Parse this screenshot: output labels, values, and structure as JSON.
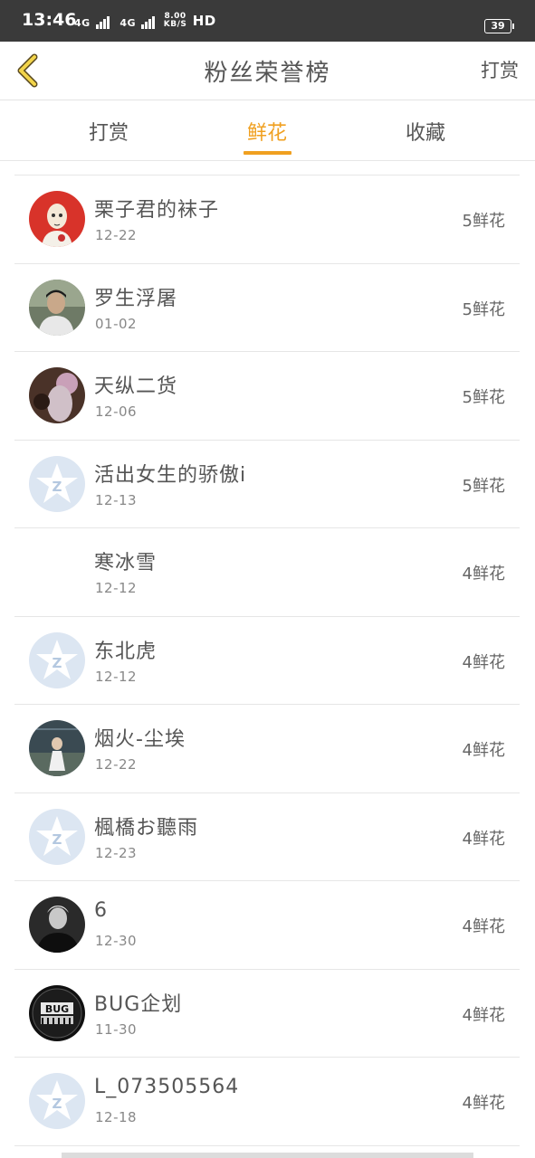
{
  "status_bar": {
    "time": "13:46",
    "network_1": "4G",
    "network_2": "4G",
    "speed_value": "8.00",
    "speed_unit": "KB/S",
    "hd": "HD",
    "battery": "39"
  },
  "header": {
    "title": "粉丝荣誉榜",
    "right_button": "打赏",
    "back_icon": "chevron-left-icon"
  },
  "tabs": [
    {
      "label": "打赏",
      "active": false
    },
    {
      "label": "鲜花",
      "active": true
    },
    {
      "label": "收藏",
      "active": false
    }
  ],
  "colors": {
    "accent": "#f0a020",
    "status_bar": "#3a3a3a",
    "default_avatar": "#dce6f2"
  },
  "fans": [
    {
      "name": "栗子君的袜子",
      "date": "12-22",
      "count": "5鲜花",
      "avatar": "photo-avatar"
    },
    {
      "name": "罗生浮屠",
      "date": "01-02",
      "count": "5鲜花",
      "avatar": "photo-avatar"
    },
    {
      "name": "天纵二货",
      "date": "12-06",
      "count": "5鲜花",
      "avatar": "photo-avatar"
    },
    {
      "name": "活出女生的骄傲i",
      "date": "12-13",
      "count": "5鲜花",
      "avatar": "default-qq-avatar"
    },
    {
      "name": "寒冰雪",
      "date": "12-12",
      "count": "4鲜花",
      "avatar": "blank-avatar"
    },
    {
      "name": "东北虎",
      "date": "12-12",
      "count": "4鲜花",
      "avatar": "default-qq-avatar"
    },
    {
      "name": "烟火-尘埃",
      "date": "12-22",
      "count": "4鲜花",
      "avatar": "photo-avatar"
    },
    {
      "name": "楓橋お聽雨",
      "date": "12-23",
      "count": "4鲜花",
      "avatar": "default-qq-avatar"
    },
    {
      "name": "6",
      "date": "12-30",
      "count": "4鲜花",
      "avatar": "photo-avatar"
    },
    {
      "name": "BUG企划",
      "date": "11-30",
      "count": "4鲜花",
      "avatar": "logo-avatar"
    },
    {
      "name": "L_073505564",
      "date": "12-18",
      "count": "4鲜花",
      "avatar": "default-qq-avatar"
    }
  ]
}
